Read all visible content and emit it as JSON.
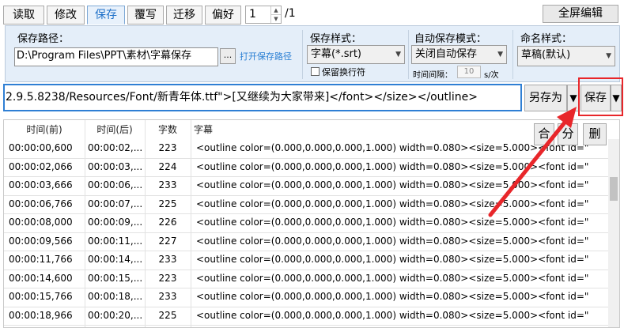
{
  "tabs": [
    "读取",
    "修改",
    "保存",
    "覆写",
    "迁移",
    "偏好"
  ],
  "active_tab": "保存",
  "page": {
    "current": "1",
    "total": "/1"
  },
  "fullscreen_label": "全屏编辑",
  "save_path": {
    "label": "保存路径：",
    "value": "D:\\Program Files\\PPT\\素材\\字幕保存",
    "browse_label": "...",
    "open_link": "打开保存路径"
  },
  "save_style": {
    "label": "保存样式：",
    "value": "字幕(*.srt)",
    "keep_newline": "保留换行符"
  },
  "auto_save": {
    "label": "自动保存模式：",
    "value": "关闭自动保存",
    "interval_label": "时间间隔：",
    "interval_value": "10",
    "interval_unit": "s/次"
  },
  "naming": {
    "label": "命名样式：",
    "value": "草稿(默认)"
  },
  "editor_text": "2.9.5.8238/Resources/Font/新青年体.ttf\">[又继续为大家带来]</font></size></outline>",
  "save_as_label": "另存为",
  "save_label": "保存",
  "dropdown_arrow": "▼",
  "table": {
    "headers": [
      "时间(前)",
      "时间(后)",
      "字数",
      "字幕"
    ],
    "side_buttons": [
      "合",
      "分",
      "删"
    ],
    "rows": [
      [
        "00:00:00,600",
        "00:00:02,...",
        "223",
        "<outline color=(0.000,0.000,0.000,1.000) width=0.080><size=5.000><font id=\""
      ],
      [
        "00:00:02,066",
        "00:00:03,...",
        "224",
        "<outline color=(0.000,0.000,0.000,1.000) width=0.080><size=5.000><font id=\""
      ],
      [
        "00:00:03,666",
        "00:00:06,...",
        "233",
        "<outline color=(0.000,0.000,0.000,1.000) width=0.080><size=5.000><font id=\""
      ],
      [
        "00:00:06,766",
        "00:00:07,...",
        "225",
        "<outline color=(0.000,0.000,0.000,1.000) width=0.080><size=5.000><font id=\""
      ],
      [
        "00:00:08,000",
        "00:00:09,...",
        "226",
        "<outline color=(0.000,0.000,0.000,1.000) width=0.080><size=5.000><font id=\""
      ],
      [
        "00:00:09,566",
        "00:00:11,...",
        "227",
        "<outline color=(0.000,0.000,0.000,1.000) width=0.080><size=5.000><font id=\""
      ],
      [
        "00:00:11,766",
        "00:00:14,...",
        "233",
        "<outline color=(0.000,0.000,0.000,1.000) width=0.080><size=5.000><font id=\""
      ],
      [
        "00:00:14,600",
        "00:00:15,...",
        "223",
        "<outline color=(0.000,0.000,0.000,1.000) width=0.080><size=5.000><font id=\""
      ],
      [
        "00:00:15,766",
        "00:00:18,...",
        "233",
        "<outline color=(0.000,0.000,0.000,1.000) width=0.080><size=5.000><font id=\""
      ],
      [
        "00:00:18,966",
        "00:00:20,...",
        "225",
        "<outline color=(0.000,0.000,0.000,1.000) width=0.080><size=5.000><font id=\""
      ]
    ]
  },
  "colors": {
    "accent": "#2f7fd4",
    "annotation_red": "#e8262a"
  }
}
